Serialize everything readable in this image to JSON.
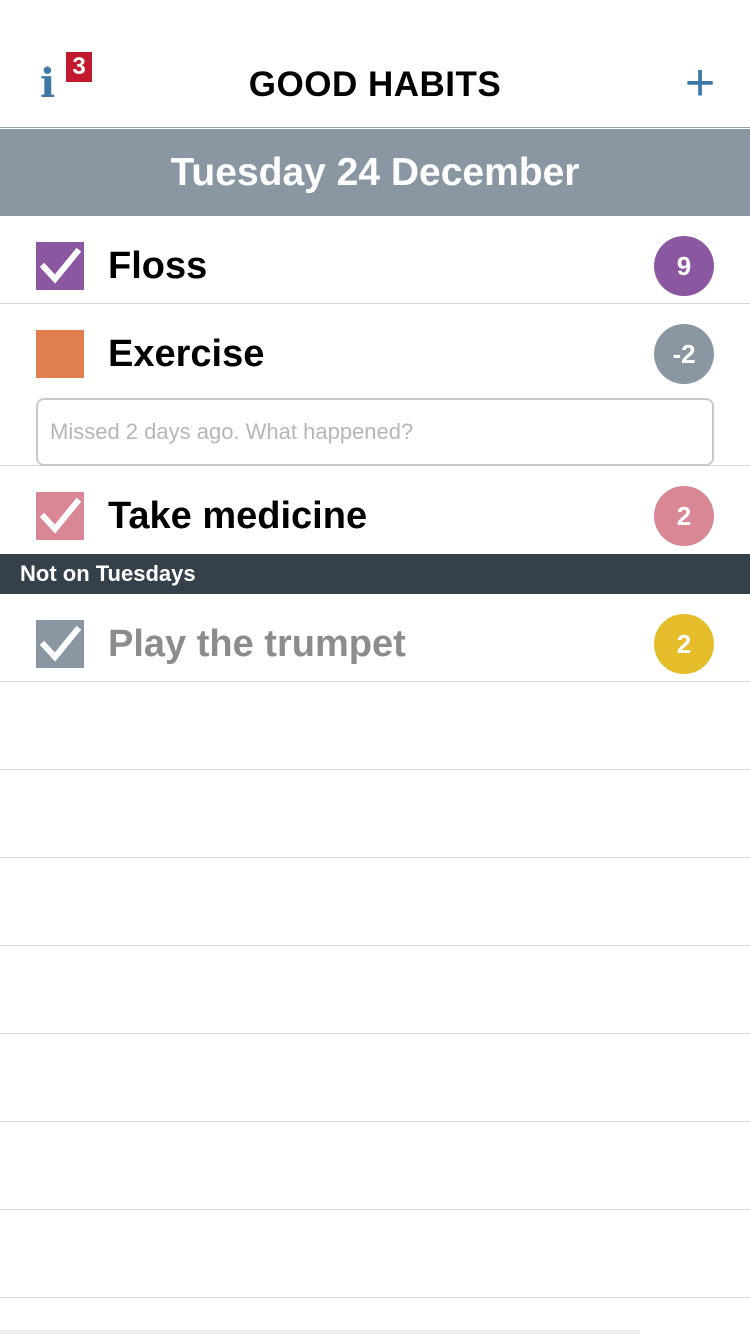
{
  "nav": {
    "info_icon": "i",
    "info_badge": "3",
    "title": "GOOD HABITS",
    "add_label": "+",
    "accent": "#3d78a6",
    "badge_color": "#c3192f"
  },
  "date_header": "Tuesday 24 December",
  "habits": [
    {
      "name": "Floss",
      "checked": true,
      "color": "#8b57a0",
      "count": "9"
    },
    {
      "name": "Exercise",
      "checked": false,
      "color": "#e17f4f",
      "count": "-2"
    },
    {
      "name": "Take medicine",
      "checked": true,
      "color": "#d98795",
      "count": "2"
    }
  ],
  "exercise_note": {
    "placeholder": "Missed 2 days ago. What happened?",
    "value": ""
  },
  "section": {
    "title": "Not on Tuesdays"
  },
  "off_day_habits": [
    {
      "name": "Play the trumpet",
      "checked": true,
      "color": "#8a97a3",
      "count": "2",
      "count_color": "#e5bd2a"
    }
  ],
  "colors": {
    "count_negative": "#8a97a3",
    "date_bar": "#8a97a3",
    "section_bar": "#36404b"
  }
}
